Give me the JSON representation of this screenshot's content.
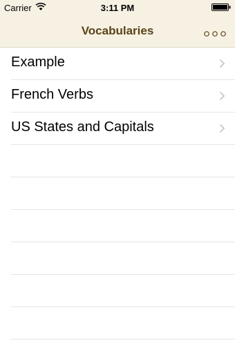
{
  "status_bar": {
    "carrier": "Carrier",
    "time": "3:11 PM"
  },
  "nav": {
    "title": "Vocabularies",
    "more_icon": "more-dots-icon"
  },
  "vocabularies": [
    {
      "label": "Example"
    },
    {
      "label": "French Verbs"
    },
    {
      "label": "US States and Capitals"
    }
  ],
  "colors": {
    "nav_background": "#f6f1e3",
    "nav_title": "#5a4317",
    "separator": "#e4e4e4"
  }
}
